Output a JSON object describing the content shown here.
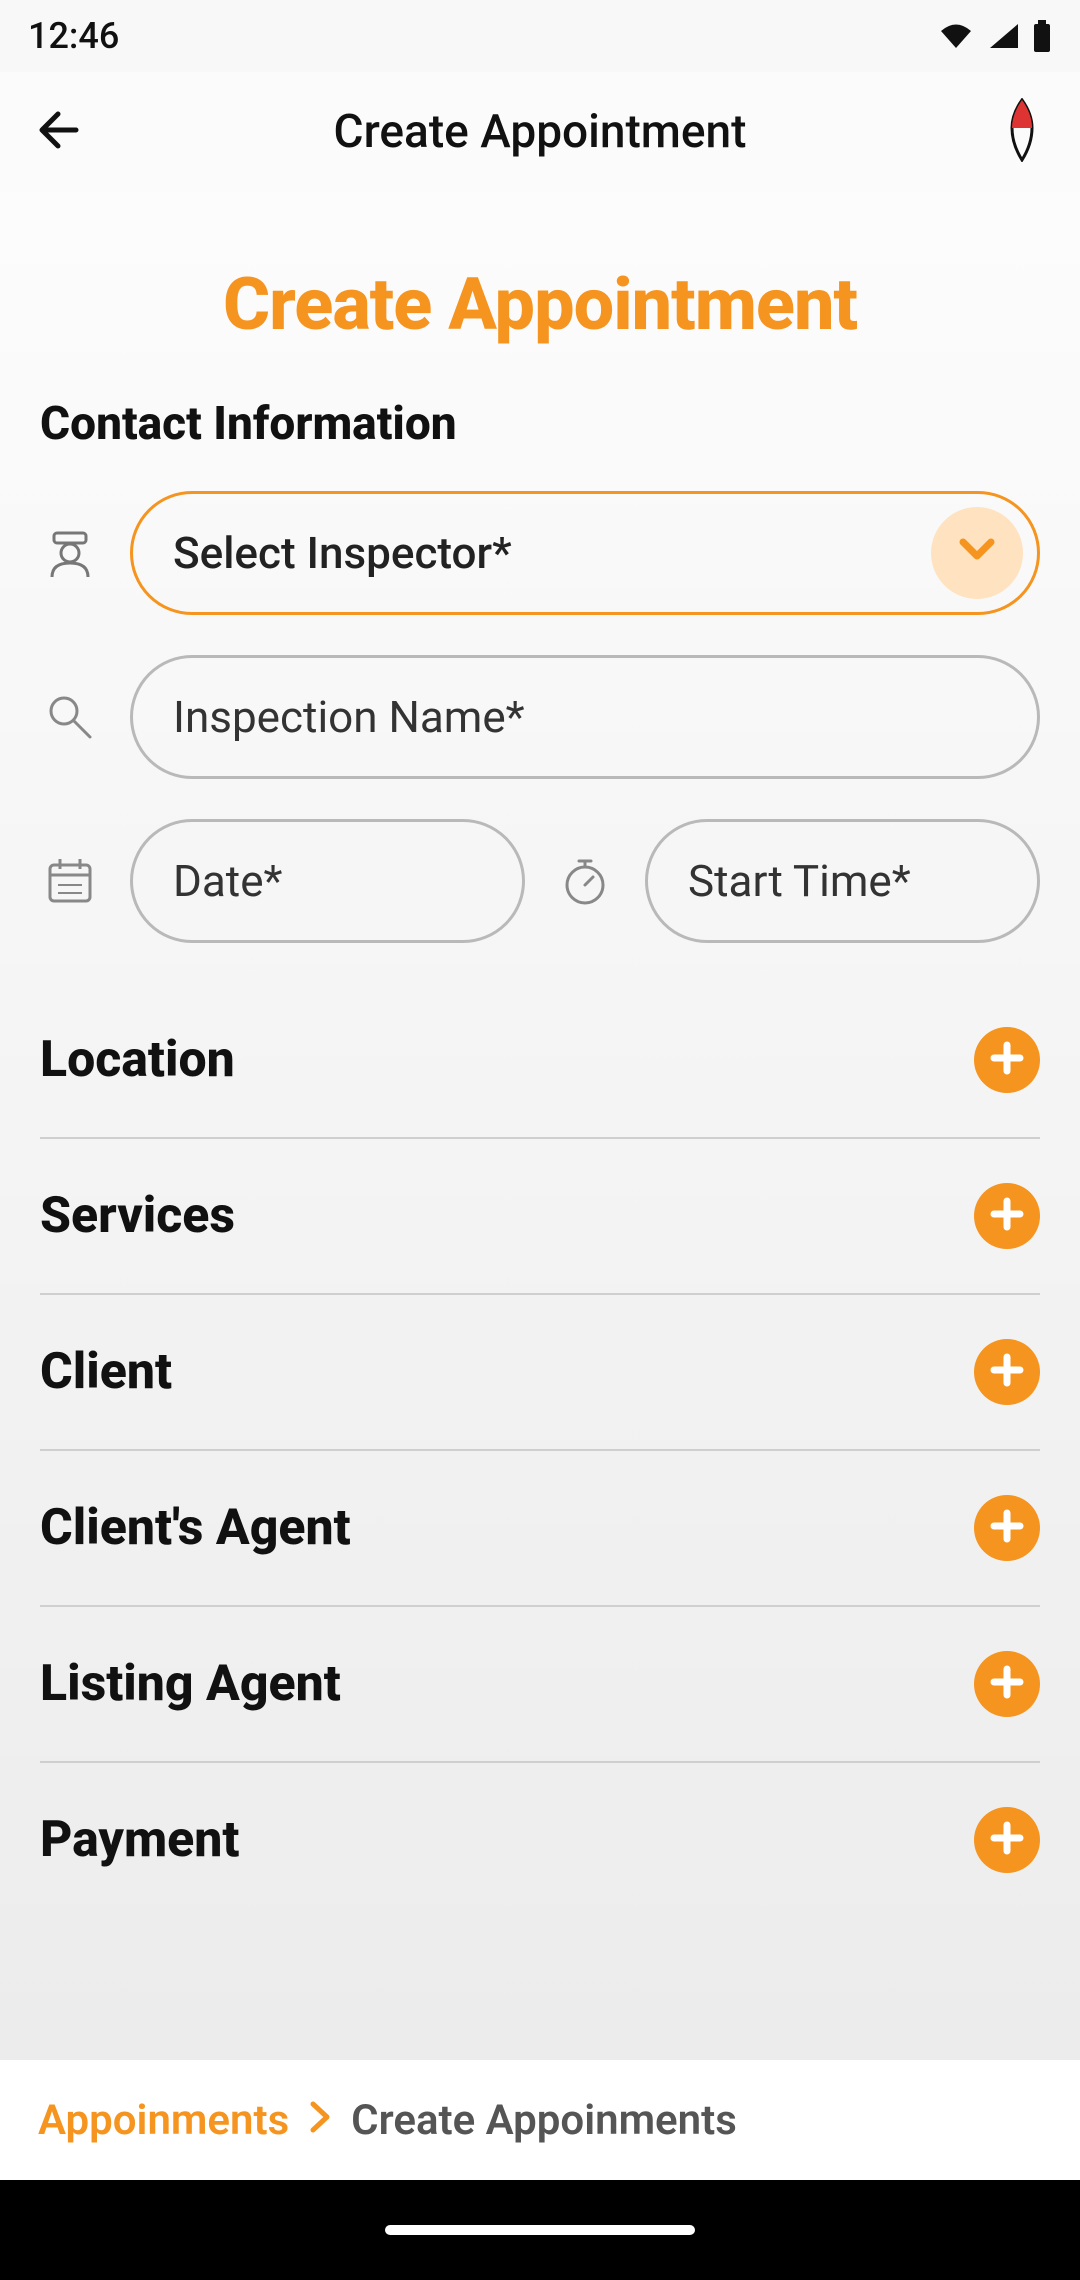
{
  "status": {
    "time": "12:46"
  },
  "appbar": {
    "title": "Create Appointment"
  },
  "page": {
    "heading": "Create Appointment",
    "contact_section_title": "Contact Information"
  },
  "form": {
    "inspector_select": {
      "label": "Select Inspector*"
    },
    "inspection_name": {
      "placeholder": "Inspection Name*"
    },
    "date": {
      "placeholder": "Date*"
    },
    "start_time": {
      "placeholder": "Start Time*"
    }
  },
  "sections": [
    {
      "title": "Location"
    },
    {
      "title": "Services"
    },
    {
      "title": "Client"
    },
    {
      "title": "Client's Agent"
    },
    {
      "title": "Listing Agent"
    },
    {
      "title": "Payment"
    }
  ],
  "breadcrumb": {
    "parent": "Appoinments",
    "current": "Create Appoinments"
  },
  "colors": {
    "accent": "#f5941f"
  }
}
